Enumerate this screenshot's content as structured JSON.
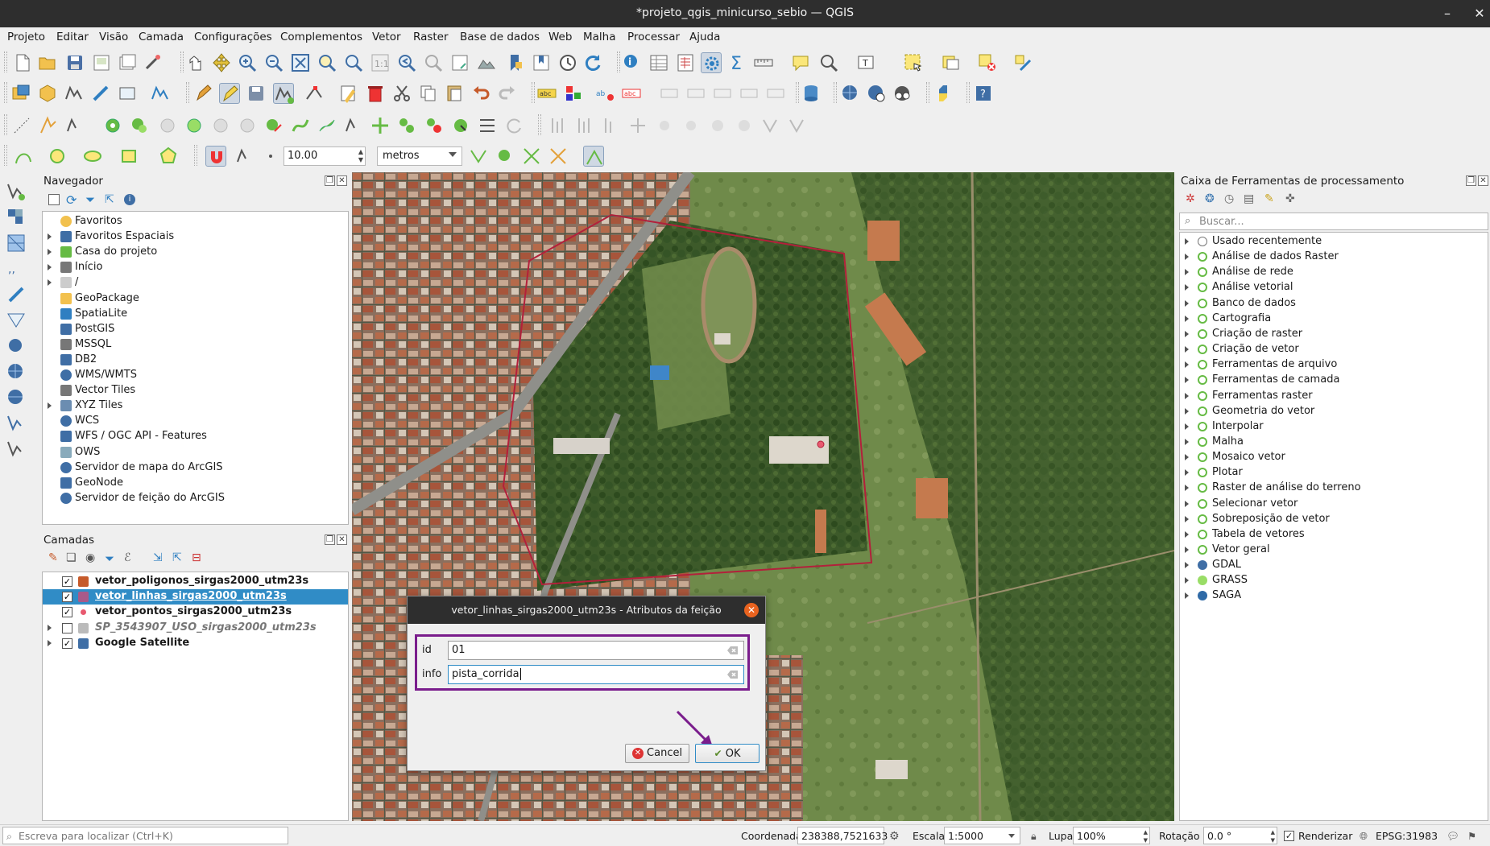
{
  "window": {
    "title": "*projeto_qgis_minicurso_sebio — QGIS",
    "minimize": "–",
    "close": "✕"
  },
  "menu": [
    "Projeto",
    "Editar",
    "Visão",
    "Camada",
    "Configurações",
    "Complementos",
    "Vetor",
    "Raster",
    "Base de dados",
    "Web",
    "Malha",
    "Processar",
    "Ajuda"
  ],
  "snapping": {
    "tolerance": "10.00",
    "units": "metros"
  },
  "navigator": {
    "title": "Navegador",
    "items": [
      {
        "label": "Favoritos",
        "expandable": false,
        "icon": "star-icon"
      },
      {
        "label": "Favoritos Espaciais",
        "expandable": true,
        "icon": "spatial-bookmark-icon"
      },
      {
        "label": "Casa do projeto",
        "expandable": true,
        "icon": "project-home-icon"
      },
      {
        "label": "Início",
        "expandable": true,
        "icon": "home-icon"
      },
      {
        "label": "/",
        "expandable": true,
        "icon": "folder-icon"
      },
      {
        "label": "GeoPackage",
        "expandable": false,
        "icon": "geopackage-icon"
      },
      {
        "label": "SpatiaLite",
        "expandable": false,
        "icon": "spatialite-icon"
      },
      {
        "label": "PostGIS",
        "expandable": false,
        "icon": "postgis-icon"
      },
      {
        "label": "MSSQL",
        "expandable": false,
        "icon": "mssql-icon"
      },
      {
        "label": "DB2",
        "expandable": false,
        "icon": "db2-icon"
      },
      {
        "label": "WMS/WMTS",
        "expandable": false,
        "icon": "globe-icon"
      },
      {
        "label": "Vector Tiles",
        "expandable": false,
        "icon": "vector-tiles-icon"
      },
      {
        "label": "XYZ Tiles",
        "expandable": true,
        "icon": "xyz-tiles-icon"
      },
      {
        "label": "WCS",
        "expandable": false,
        "icon": "globe-icon"
      },
      {
        "label": "WFS / OGC API - Features",
        "expandable": false,
        "icon": "wfs-icon"
      },
      {
        "label": "OWS",
        "expandable": false,
        "icon": "ows-icon"
      },
      {
        "label": "Servidor de mapa do ArcGIS",
        "expandable": false,
        "icon": "globe-icon"
      },
      {
        "label": "GeoNode",
        "expandable": false,
        "icon": "geonode-icon"
      },
      {
        "label": "Servidor de feição do ArcGIS",
        "expandable": false,
        "icon": "globe-icon"
      }
    ]
  },
  "layers": {
    "title": "Camadas",
    "items": [
      {
        "label": "vetor_poligonos_sirgas2000_utm23s",
        "checked": true,
        "selected": false,
        "italic": false,
        "icon": "polygon-layer-icon",
        "expandable": false
      },
      {
        "label": "vetor_linhas_sirgas2000_utm23s",
        "checked": true,
        "selected": true,
        "italic": false,
        "icon": "line-layer-icon",
        "expandable": false
      },
      {
        "label": "vetor_pontos_sirgas2000_utm23s",
        "checked": true,
        "selected": false,
        "italic": false,
        "icon": "point-layer-icon",
        "expandable": false
      },
      {
        "label": "SP_3543907_USO_sirgas2000_utm23s",
        "checked": false,
        "selected": false,
        "italic": true,
        "icon": "group-layer-icon",
        "expandable": true
      },
      {
        "label": "Google Satellite",
        "checked": true,
        "selected": false,
        "italic": false,
        "icon": "raster-layer-icon",
        "expandable": true
      }
    ]
  },
  "processing": {
    "title": "Caixa de Ferramentas de processamento",
    "search_placeholder": "Buscar...",
    "items": [
      "Usado recentemente",
      "Análise de dados Raster",
      "Análise de rede",
      "Análise vetorial",
      "Banco de dados",
      "Cartografia",
      "Criação de raster",
      "Criação de vetor",
      "Ferramentas de arquivo",
      "Ferramentas de camada",
      "Ferramentas raster",
      "Geometria do vetor",
      "Interpolar",
      "Malha",
      "Mosaico vetor",
      "Plotar",
      "Raster de análise do terreno",
      "Selecionar vetor",
      "Sobreposição de vetor",
      "Tabela de vetores",
      "Vetor geral",
      "GDAL",
      "GRASS",
      "SAGA"
    ]
  },
  "dialog": {
    "title": "vetor_linhas_sirgas2000_utm23s - Atributos da feição",
    "fields": [
      {
        "label": "id",
        "value": "01"
      },
      {
        "label": "info",
        "value": "pista_corrida"
      }
    ],
    "cancel": "Cancel",
    "ok": "OK"
  },
  "status": {
    "locator_placeholder": "Escreva para localizar (Ctrl+K)",
    "coord_label": "Coordenada",
    "coord_value": "238388,7521633",
    "scale_label": "Escala",
    "scale_value": "1:5000",
    "magnifier_label": "Lupa",
    "magnifier_value": "100%",
    "rotation_label": "Rotação",
    "rotation_value": "0.0 °",
    "render_label": "Renderizar",
    "crs": "EPSG:31983"
  }
}
